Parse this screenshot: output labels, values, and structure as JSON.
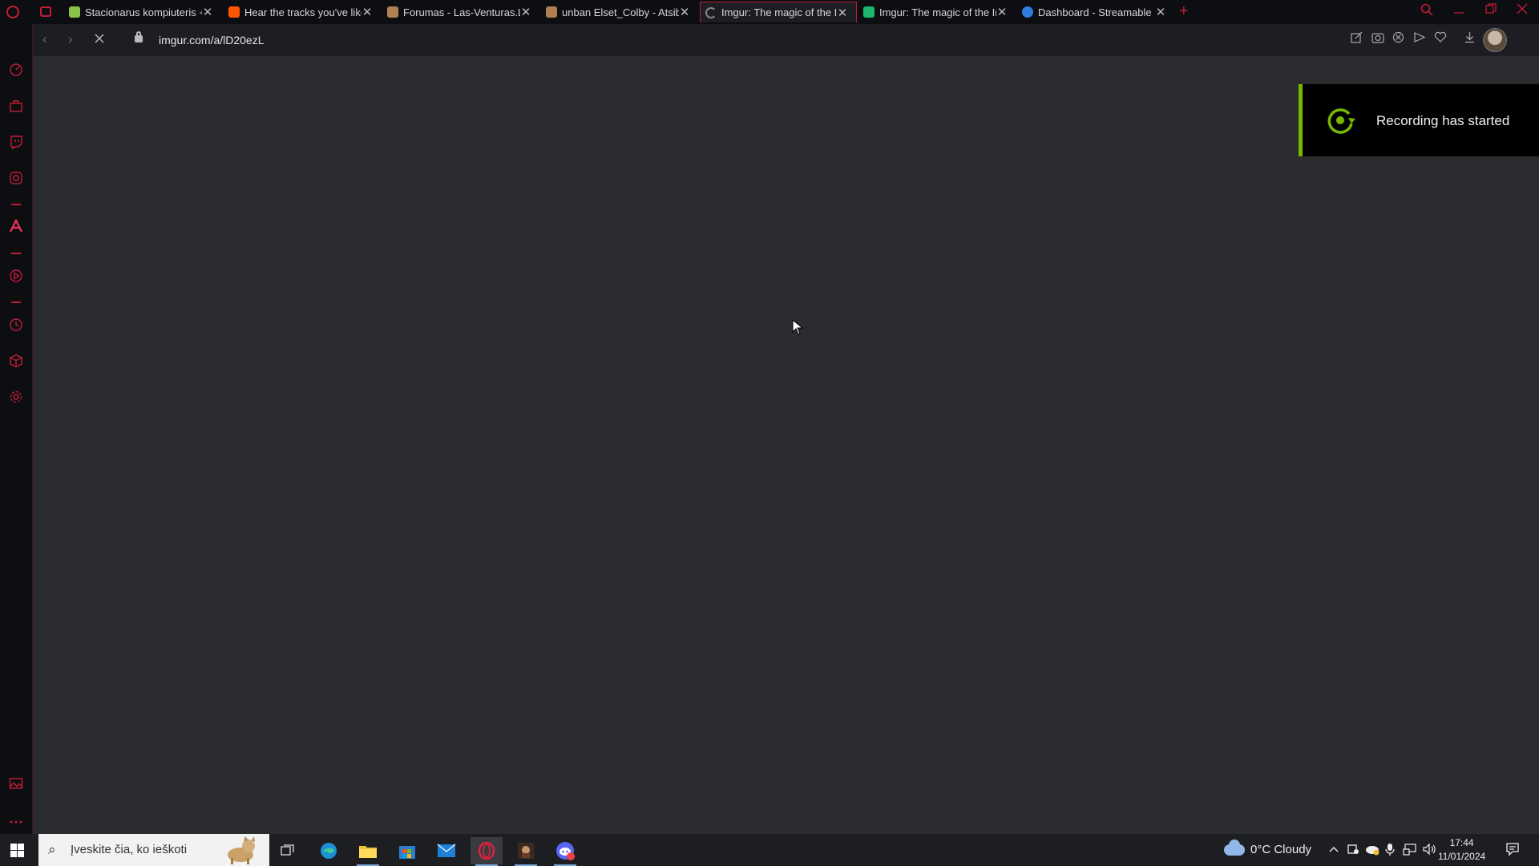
{
  "browser": {
    "tabs": [
      {
        "label": "Stacionarus kompiuteris + ",
        "favicon_color": "#8bc34a",
        "active": false
      },
      {
        "label": "Hear the tracks you've liked",
        "favicon_color": "#ff5500",
        "active": false
      },
      {
        "label": "Forumas - Las-Venturas.LT",
        "favicon_color": "#b08050",
        "active": false
      },
      {
        "label": "unban Elset_Colby - Atsiblo",
        "favicon_color": "#b08050",
        "active": false
      },
      {
        "label": "Imgur: The magic of the Int",
        "favicon_color": "#888888",
        "active": true,
        "loading": true
      },
      {
        "label": "Imgur: The magic of the Int",
        "favicon_color": "#1bb76e",
        "active": false
      },
      {
        "label": "Dashboard - Streamable",
        "favicon_color": "#2f7de1",
        "active": false
      }
    ],
    "close_glyph": "✕",
    "new_tab_glyph": "+",
    "url": "imgur.com/a/lD20ezL",
    "accent_color": "#c21c36"
  },
  "notification": {
    "text": "Recording has started",
    "accent_color": "#76b900",
    "icon": "recording-icon"
  },
  "taskbar": {
    "search_placeholder": "Įveskite čia, ko ieškoti",
    "weather": "0°C  Cloudy",
    "time": "17:44",
    "date": "11/01/2024"
  }
}
